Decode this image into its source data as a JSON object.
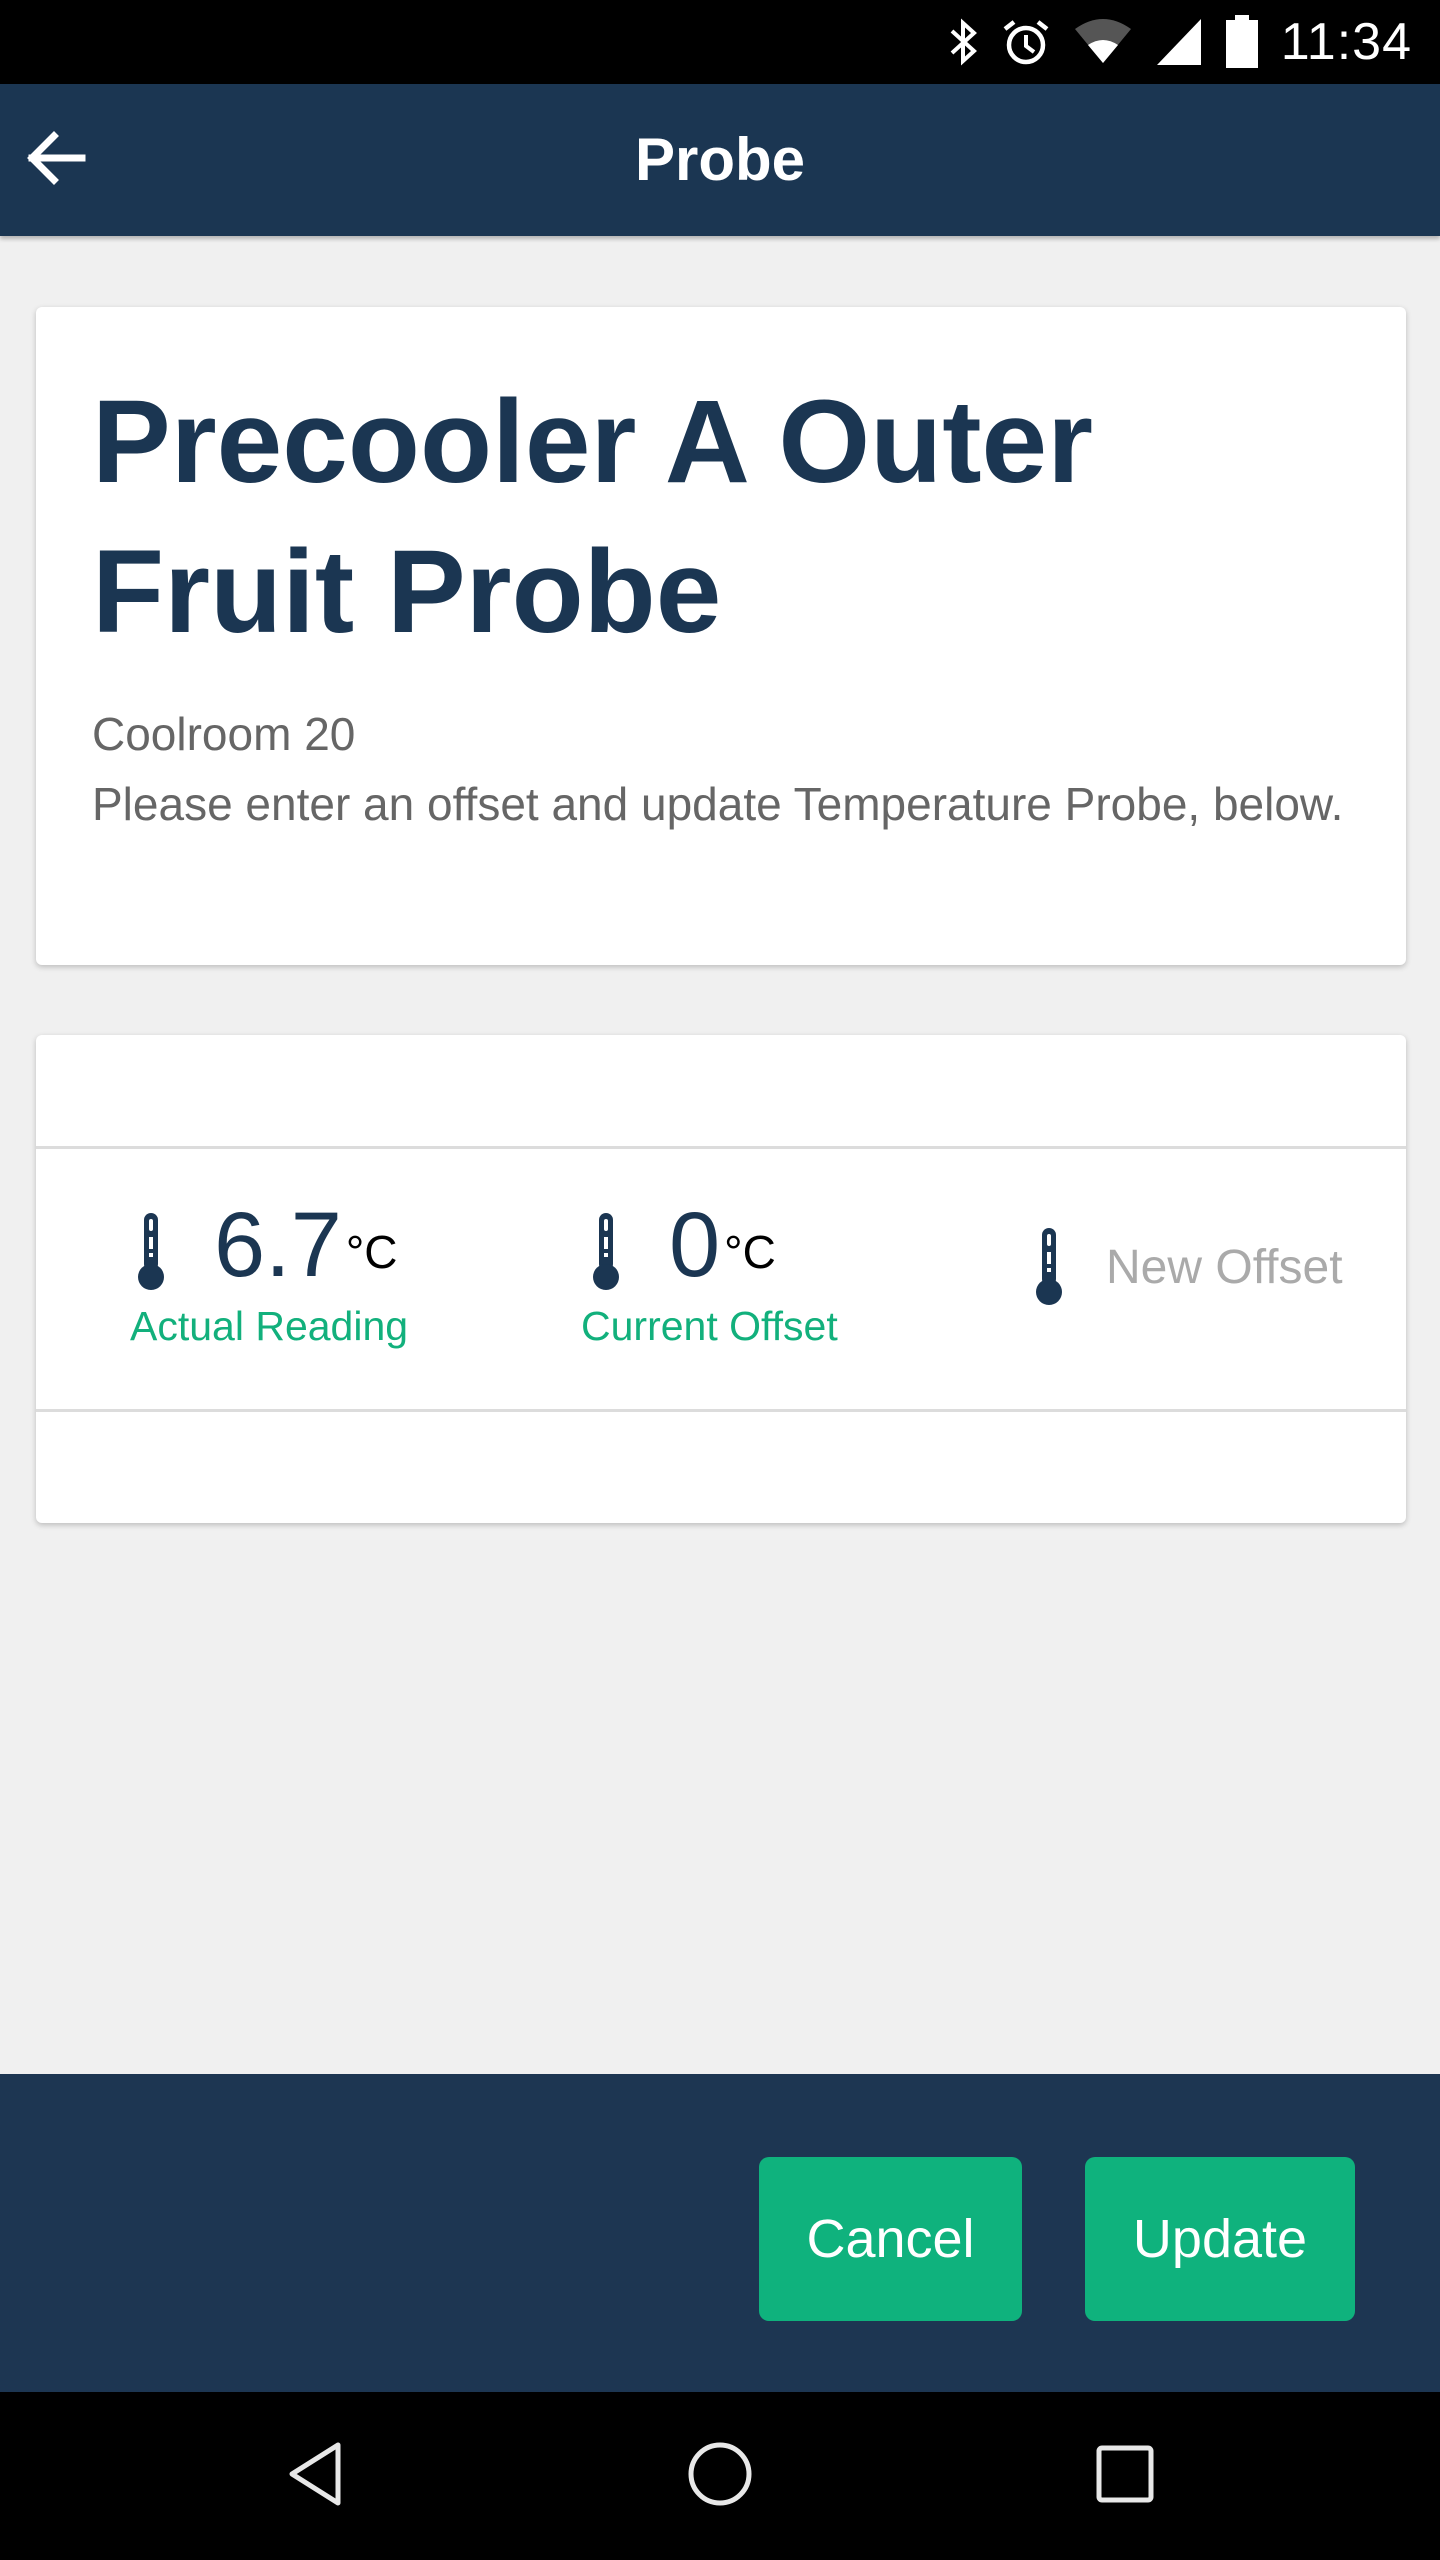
{
  "status_bar": {
    "time": "11:34",
    "icons": [
      "bluetooth-icon",
      "alarm-icon",
      "wifi-icon",
      "cell-signal-icon",
      "battery-icon"
    ]
  },
  "app_bar": {
    "title": "Probe",
    "back_icon": "arrow-left-icon"
  },
  "probe": {
    "name": "Precooler A Outer Fruit Probe",
    "location": "Coolroom 20",
    "instruction": "Please enter an offset and update Temperature Probe, below."
  },
  "readings": {
    "actual": {
      "value": "6.7",
      "unit": "°C",
      "label": "Actual Reading",
      "icon": "thermometer-icon"
    },
    "current_offset": {
      "value": "0",
      "unit": "°C",
      "label": "Current Offset",
      "icon": "thermometer-icon"
    },
    "new_offset": {
      "value": "",
      "placeholder": "New Offset",
      "icon": "thermometer-icon"
    }
  },
  "actions": {
    "cancel_label": "Cancel",
    "update_label": "Update"
  },
  "nav_bar": {
    "icons": [
      "nav-back-icon",
      "nav-home-icon",
      "nav-recents-icon"
    ]
  },
  "colors": {
    "primary": "#1b3652",
    "accent": "#0fb27d",
    "background": "#f0f0f0",
    "muted_text": "#666666",
    "placeholder": "#aaaaaa"
  }
}
